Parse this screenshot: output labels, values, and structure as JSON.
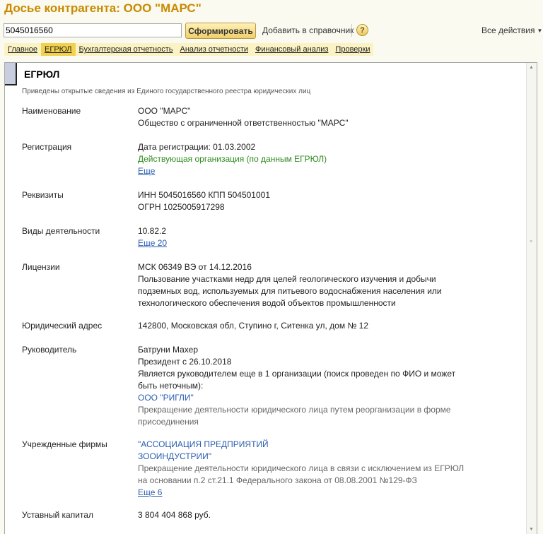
{
  "title": "Досье контрагента: ООО \"МАРС\"",
  "toolbar": {
    "search_value": "5045016560",
    "generate_label": "Сформировать",
    "add_label": "Добавить в справочник",
    "help_icon": "?",
    "all_actions_label": "Все действия",
    "chevron": "▼"
  },
  "tabs": [
    "Главное",
    "ЕГРЮЛ",
    "Бухгалтерская отчетность",
    "Анализ отчетности",
    "Финансовый анализ",
    "Проверки"
  ],
  "section": {
    "title": "ЕГРЮЛ",
    "description": "Приведены открытые сведения из Единого государственного реестра юридических лиц"
  },
  "rows": {
    "name": {
      "label": "Наименование",
      "line1": "ООО \"МАРС\"",
      "line2": "Общество с ограниченной ответственностью \"МАРС\""
    },
    "registration": {
      "label": "Регистрация",
      "date": "Дата регистрации: 01.03.2002",
      "status": "Действующая организация (по данным ЕГРЮЛ)",
      "more": "Еще"
    },
    "requisites": {
      "label": "Реквизиты",
      "inn_kpp": "ИНН 5045016560 КПП 504501001",
      "ogrn": "ОГРН 1025005917298"
    },
    "activities": {
      "label": "Виды деятельности",
      "code": "10.82.2",
      "more": "Еще 20"
    },
    "licenses": {
      "label": "Лицензии",
      "number": "МСК 06349 ВЭ от 14.12.2016",
      "desc1": "Пользование участками недр для целей геологического изучения и добычи",
      "desc2": "подземных вод, используемых для питьевого водоснабжения населения или",
      "desc3": "технологического обеспечения водой объектов промышленности"
    },
    "address": {
      "label": "Юридический адрес",
      "value": "142800, Московская обл, Ступино г, Ситенка ул, дом № 12"
    },
    "director": {
      "label": "Руководитель",
      "name": "Батруни Махер",
      "position": "Президент с 26.10.2018",
      "note1": "Является руководителем еще в 1 организации (поиск проведен по ФИО и может",
      "note2": "быть неточным):",
      "org": "ООО \"РИГЛИ\"",
      "org_status1": "Прекращение деятельности юридического лица путем реорганизации в форме",
      "org_status2": "присоединения"
    },
    "founded": {
      "label": "Учрежденные фирмы",
      "org1": "\"АССОЦИАЦИЯ ПРЕДПРИЯТИЙ",
      "org2": "ЗООИНДУСТРИИ\"",
      "status1": "Прекращение деятельности юридического лица в связи с исключением из ЕГРЮЛ",
      "status2": "на основании п.2 ст.21.1 Федерального закона от 08.08.2001 №129-ФЗ",
      "more": "Еще 6"
    },
    "capital": {
      "label": "Уставный капитал",
      "value": "3 804 404 868 руб."
    }
  }
}
